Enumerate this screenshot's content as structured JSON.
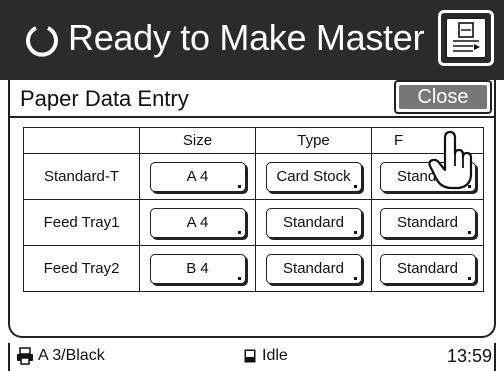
{
  "header": {
    "title": "Ready to Make Master",
    "status_icon": "ready-circle-icon",
    "menu_icon": "master-menu-icon",
    "background": "#2b2b2b"
  },
  "panel": {
    "title": "Paper Data Entry",
    "close_label": "Close",
    "close_color": "#777777",
    "pointer_icon": "pointing-hand-icon"
  },
  "table": {
    "columns": [
      "Size",
      "Type",
      "F"
    ],
    "rows": [
      {
        "label": "Standard-T",
        "size": "A 4",
        "type": "Card Stock",
        "feed": "Standard"
      },
      {
        "label": "Feed Tray1",
        "size": "A 4",
        "type": "Standard",
        "feed": "Standard"
      },
      {
        "label": "Feed Tray2",
        "size": "B 4",
        "type": "Standard",
        "feed": "Standard"
      }
    ]
  },
  "statusbar": {
    "paper": "A 3/Black",
    "state": "Idle",
    "time": "13:59"
  }
}
